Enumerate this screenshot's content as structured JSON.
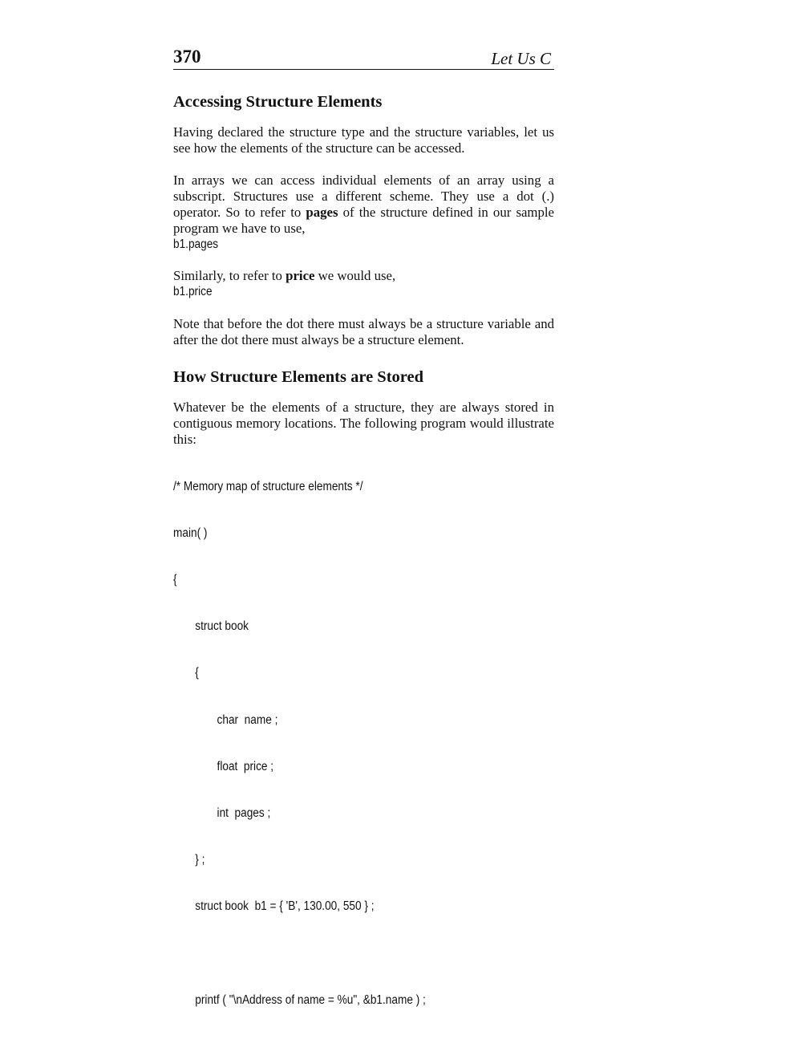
{
  "header": {
    "page_number": "370",
    "book_title": "Let Us C"
  },
  "section_access": {
    "heading": "Accessing Structure Elements",
    "para1": "Having declared the structure type and the structure variables, let us see how the elements of the structure can be accessed.",
    "para2_before_pages": "In arrays we can access individual elements of an array using a subscript. Structures use a different scheme. They use a dot (.) operator. So to refer to ",
    "para2_bold_pages": "pages",
    "para2_after_pages": " of the structure defined in our sample program we have to use,",
    "code_pages": "b1.pages",
    "para3_before_price": "Similarly, to refer to ",
    "para3_bold_price": "price",
    "para3_after_price": " we would use,",
    "code_price": "b1.price",
    "para4": "Note that before the dot there must always be a structure variable and after the dot there must always be a structure element."
  },
  "section_store": {
    "heading": "How Structure Elements are Stored",
    "para1": "Whatever be the elements of a structure, they are always stored in contiguous memory locations. The following program would illustrate this:",
    "code_lines": [
      "/* Memory map of structure elements */",
      "main( )",
      "{",
      "struct book",
      "{",
      "char  name ;",
      "float  price ;",
      "int  pages ;",
      "} ;",
      "struct book  b1 = { 'B', 130.00, 550 } ;",
      "",
      "printf ( \"\\nAddress of name = %u\", &b1.name ) ;"
    ]
  }
}
